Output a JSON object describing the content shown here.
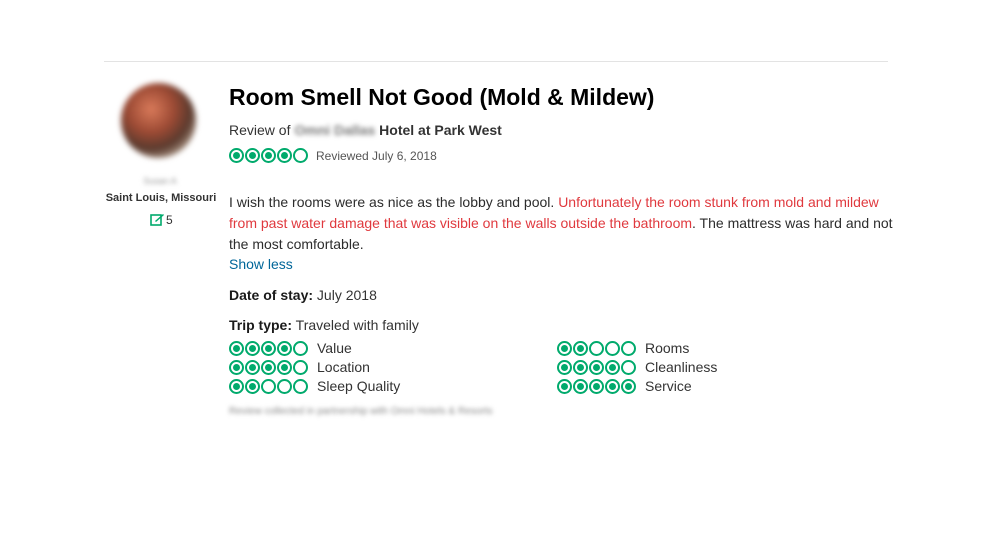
{
  "member": {
    "username": "Susan A",
    "hometown": "Saint Louis, Missouri",
    "contributions": "5"
  },
  "review": {
    "title": "Room Smell Not Good (Mold & Mildew)",
    "review_of_prefix": "Review of",
    "hotel_blurred": "Omni Dallas",
    "hotel_suffix": "Hotel at Park West",
    "rating": 4,
    "reviewed_date": "Reviewed July 6, 2018",
    "body_plain_1": "I wish the rooms were as nice as the lobby and pool. ",
    "body_highlight": "Unfortunately the room stunk from mold and mildew from past water damage that was visible on the walls outside the bathroom",
    "body_plain_2": ". The mattress was hard and not the most comfortable.",
    "show_less": "Show less",
    "date_of_stay_label": "Date of stay:",
    "date_of_stay": "July 2018",
    "trip_type_label": "Trip type:",
    "trip_type": "Traveled with family",
    "partner_note": "Review collected in partnership with Omni Hotels & Resorts"
  },
  "subratings": [
    {
      "label": "Value",
      "rating": 4
    },
    {
      "label": "Rooms",
      "rating": 2
    },
    {
      "label": "Location",
      "rating": 4
    },
    {
      "label": "Cleanliness",
      "rating": 4
    },
    {
      "label": "Sleep Quality",
      "rating": 2
    },
    {
      "label": "Service",
      "rating": 5
    }
  ],
  "colors": {
    "bubble": "#00aa6c",
    "highlight": "#e0393e",
    "link": "#006699"
  },
  "icons": {
    "contributions": "review-pencil-icon",
    "rating": "rating-bubble-icon"
  }
}
